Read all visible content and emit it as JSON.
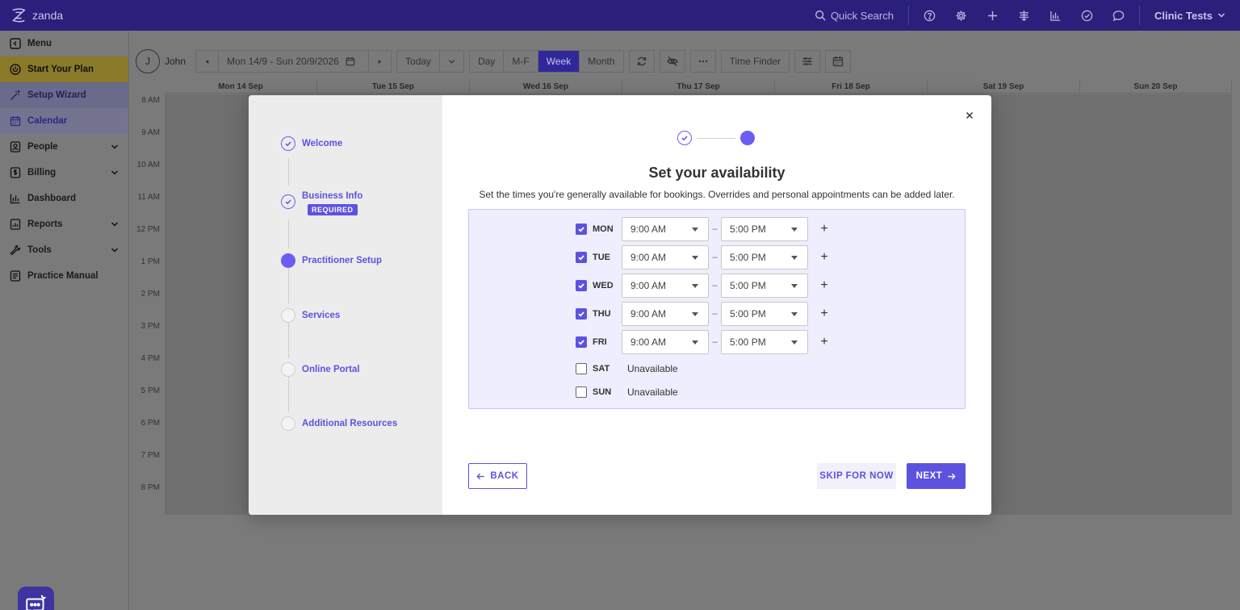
{
  "app": {
    "logo_text": "zanda"
  },
  "topbar": {
    "search_label": "Quick Search",
    "clinic_name": "Clinic Tests"
  },
  "sidebar": {
    "items": [
      {
        "label": "Menu"
      },
      {
        "label": "Start Your Plan"
      },
      {
        "label": "Setup Wizard"
      },
      {
        "label": "Calendar"
      },
      {
        "label": "People"
      },
      {
        "label": "Billing"
      },
      {
        "label": "Dashboard"
      },
      {
        "label": "Reports"
      },
      {
        "label": "Tools"
      },
      {
        "label": "Practice Manual"
      }
    ]
  },
  "calendar": {
    "user_initial": "J",
    "user_name": "John",
    "date_range": "Mon 14/9 - Sun 20/9/2026",
    "today_label": "Today",
    "views": [
      "Day",
      "M-F",
      "Week",
      "Month"
    ],
    "active_view": "Week",
    "time_finder_label": "Time Finder",
    "days": [
      "Mon 14 Sep",
      "Tue 15 Sep",
      "Wed 16 Sep",
      "Thu 17 Sep",
      "Fri 18 Sep",
      "Sat 19 Sep",
      "Sun 20 Sep"
    ],
    "hours": [
      "8 AM",
      "9 AM",
      "10 AM",
      "11 AM",
      "12 PM",
      "1 PM",
      "2 PM",
      "3 PM",
      "4 PM",
      "5 PM",
      "6 PM",
      "7 PM",
      "8 PM"
    ]
  },
  "wizard": {
    "steps": [
      {
        "label": "Welcome",
        "state": "done"
      },
      {
        "label": "Business Info",
        "state": "done",
        "badge": "REQUIRED"
      },
      {
        "label": "Practitioner Setup",
        "state": "current"
      },
      {
        "label": "Services",
        "state": "todo"
      },
      {
        "label": "Online Portal",
        "state": "todo"
      },
      {
        "label": "Additional Resources",
        "state": "todo"
      }
    ],
    "title": "Set your availability",
    "subtitle": "Set the times you're generally available for bookings. Overrides and personal appointments can be added later.",
    "availability": [
      {
        "day": "MON",
        "enabled": true,
        "start": "9:00 AM",
        "end": "5:00 PM"
      },
      {
        "day": "TUE",
        "enabled": true,
        "start": "9:00 AM",
        "end": "5:00 PM"
      },
      {
        "day": "WED",
        "enabled": true,
        "start": "9:00 AM",
        "end": "5:00 PM"
      },
      {
        "day": "THU",
        "enabled": true,
        "start": "9:00 AM",
        "end": "5:00 PM"
      },
      {
        "day": "FRI",
        "enabled": true,
        "start": "9:00 AM",
        "end": "5:00 PM"
      },
      {
        "day": "SAT",
        "enabled": false,
        "status": "Unavailable"
      },
      {
        "day": "SUN",
        "enabled": false,
        "status": "Unavailable"
      }
    ],
    "dash": "–",
    "plus": "+",
    "back_label": "BACK",
    "skip_label": "SKIP FOR NOW",
    "next_label": "NEXT"
  },
  "colors": {
    "brand": "#2a1f7a",
    "accent": "#5d52e0",
    "panel": "#eeeeff"
  }
}
